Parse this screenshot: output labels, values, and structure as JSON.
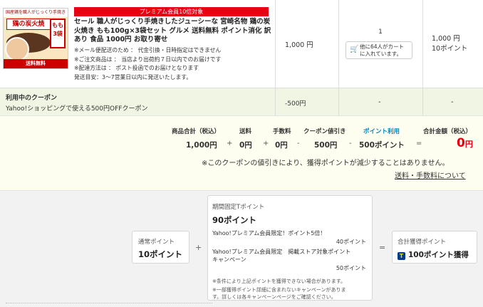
{
  "item": {
    "thumb": {
      "top_text": "国産鶏を職人がじっくり手焼き",
      "title": "鶏の炭火焼",
      "momo": "もも3袋",
      "bottom_text": "送料無料"
    },
    "badge": "プレミアム会員10倍対象",
    "title": "セール 職人がじっくり手焼きしたジューシーな 宮崎名物 鶏の炭火焼き もも100g×3袋セット グルメ 送料無料 ポイント消化 訳あり 食品 1000円 お取り寄せ",
    "notes": [
      "※メール便配送のため ： 代金引換・日時指定はできません",
      "※ご注文商品は ： 当店より出荷約７日以内でのお届けです",
      "※配達方法は ： ポスト投函でのお届けとなります",
      "発送目安：3〜7営業日以内に発送いたします。"
    ],
    "price": "1,000 円",
    "quantity": "1",
    "cart_notice_line1": "他に64人がカート",
    "cart_notice_line2": "に入れています。",
    "subtotal": "1,000 円",
    "subtotal_points": "10ポイント"
  },
  "coupon": {
    "title": "利用中のクーポン",
    "description": "Yahoo!ショッピングで使える500円OFFクーポン",
    "price": "-500円",
    "dash1": "-",
    "dash2": "-"
  },
  "summary": {
    "labels": {
      "product_total": "商品合計（税込）",
      "shipping": "送料",
      "fee": "手数料",
      "coupon_discount": "クーポン値引き",
      "points_used": "ポイント利用",
      "total": "合計金額（税込）"
    },
    "values": {
      "product_total": "1,000円",
      "shipping": "0円",
      "fee": "0円",
      "coupon_discount": "500円",
      "points_used": "500ポイント",
      "total_amount": "0",
      "total_unit": "円"
    },
    "operators": {
      "plus": "+",
      "minus": "-",
      "equals": "="
    },
    "note": "※このクーポンの値引きにより、獲得ポイントが減少することはありません。",
    "link": "送料・手数料について"
  },
  "points": {
    "normal_label": "通常ポイント",
    "normal_value": "10ポイント",
    "fixed_label": "期間固定Tポイント",
    "fixed_value": "90ポイント",
    "campaign1": "Yahoo!プレミアム会員限定！ポイント5倍！",
    "campaign1_value": "40ポイント",
    "campaign2_line1": "Yahoo!プレミアム会員限定　掲載ストア対象ポイント",
    "campaign2_line2": "キャンペーン",
    "campaign2_value": "50ポイント",
    "fine1": "※条件により上記ポイントを獲得できない場合があります。",
    "fine2_line1": "※一部獲得ポイント詳細に含まれないキャンペーンがありま",
    "fine2_line2": "す。詳しくは各キャンペーンページをご確認ください。",
    "total_label": "合計獲得ポイント",
    "total_value": "100ポイント獲得",
    "tcard_letter": "T",
    "op_plus": "+",
    "op_equals": "="
  },
  "colors": {
    "badge_red": "#e60012",
    "coupon_bg": "#f0f6e3",
    "summary_bg": "#fefef0",
    "points_blue": "#0a84b8",
    "points_area_bg": "#f2f2f2"
  }
}
